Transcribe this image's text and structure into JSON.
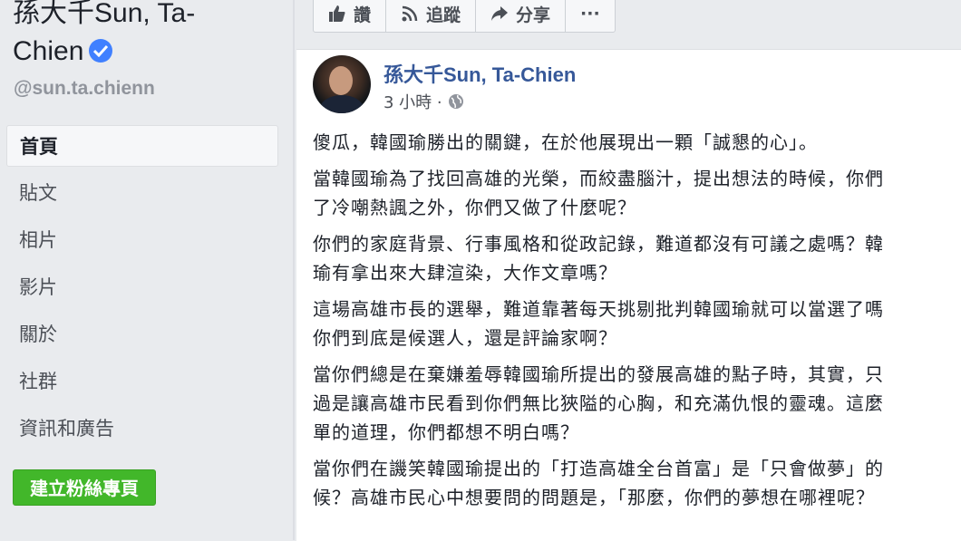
{
  "page": {
    "name_line1": "孫大千Sun, Ta-",
    "name_line2": "Chien",
    "handle": "@sun.ta.chienn"
  },
  "nav": {
    "items": [
      {
        "label": "首頁",
        "active": true
      },
      {
        "label": "貼文"
      },
      {
        "label": "相片"
      },
      {
        "label": "影片"
      },
      {
        "label": "關於"
      },
      {
        "label": "社群"
      },
      {
        "label": "資訊和廣告"
      }
    ],
    "create_button": "建立粉絲專頁"
  },
  "actions": {
    "like": "讚",
    "follow": "追蹤",
    "share": "分享",
    "more": "···"
  },
  "post": {
    "author": "孫大千Sun, Ta-Chien",
    "time": "3 小時 ·",
    "paragraphs": [
      "傻瓜，韓國瑜勝出的關鍵，在於他展現出一顆「誠懇的心」。",
      "當韓國瑜為了找回高雄的光榮，而絞盡腦汁，提出想法的時候，你們\n了冷嘲熱諷之外，你們又做了什麼呢？",
      "你們的家庭背景、行事風格和從政記錄，難道都沒有可議之處嗎？韓\n瑜有拿出來大肆渲染，大作文章嗎？",
      "這場高雄市長的選舉，難道靠著每天挑剔批判韓國瑜就可以當選了嗎\n你們到底是候選人，還是評論家啊？",
      "當你們總是在棄嫌羞辱韓國瑜所提出的發展高雄的點子時，其實，只\n過是讓高雄市民看到你們無比狹隘的心胸，和充滿仇恨的靈魂。這麼\n單的道理，你們都想不明白嗎？",
      "當你們在譏笑韓國瑜提出的「打造高雄全台首富」是「只會做夢」的\n候？高雄市民心中想要問的問題是，「那麼，你們的夢想在哪裡呢？"
    ]
  }
}
